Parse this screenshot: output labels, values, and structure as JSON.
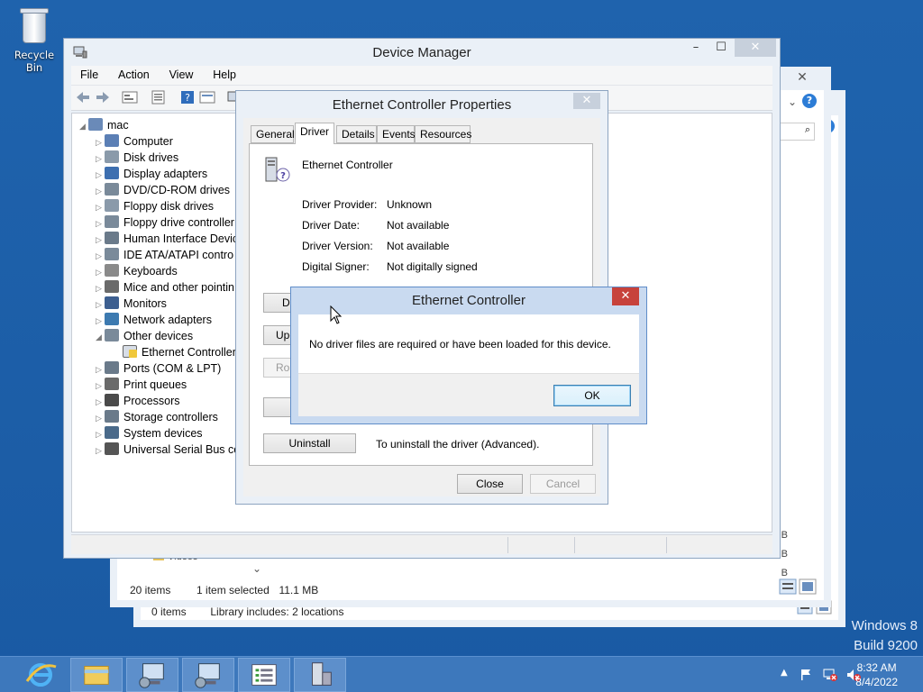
{
  "desktop": {
    "recycle_bin_label": "Recycle Bin",
    "watermark_line1": "Windows 8",
    "watermark_line2": "Build 9200"
  },
  "back_window_1": {
    "status_items": "0 items",
    "status_library": "Library includes: 2 locations"
  },
  "back_window_2": {
    "status_count": "20 items",
    "status_selected": "1 item selected",
    "status_size": "11.1 MB",
    "size_fragments": [
      "B",
      "B",
      "B"
    ],
    "partial_item": "Videos"
  },
  "device_manager": {
    "title": "Device Manager",
    "menu": [
      "File",
      "Action",
      "View",
      "Help"
    ],
    "tree": {
      "root": "mac",
      "categories": [
        {
          "label": "Computer",
          "expanded": false
        },
        {
          "label": "Disk drives",
          "expanded": false
        },
        {
          "label": "Display adapters",
          "expanded": false
        },
        {
          "label": "DVD/CD-ROM drives",
          "expanded": false
        },
        {
          "label": "Floppy disk drives",
          "expanded": false
        },
        {
          "label": "Floppy drive controller",
          "expanded": false
        },
        {
          "label": "Human Interface Devic",
          "expanded": false
        },
        {
          "label": "IDE ATA/ATAPI contro",
          "expanded": false
        },
        {
          "label": "Keyboards",
          "expanded": false
        },
        {
          "label": "Mice and other pointin",
          "expanded": false
        },
        {
          "label": "Monitors",
          "expanded": false
        },
        {
          "label": "Network adapters",
          "expanded": false
        },
        {
          "label": "Other devices",
          "expanded": true
        },
        {
          "label": "Ethernet Controller",
          "child": true
        },
        {
          "label": "Ports (COM & LPT)",
          "expanded": false
        },
        {
          "label": "Print queues",
          "expanded": false
        },
        {
          "label": "Processors",
          "expanded": false
        },
        {
          "label": "Storage controllers",
          "expanded": false
        },
        {
          "label": "System devices",
          "expanded": false
        },
        {
          "label": "Universal Serial Bus co",
          "expanded": false
        }
      ]
    }
  },
  "properties": {
    "title": "Ethernet Controller Properties",
    "tabs": [
      "General",
      "Driver",
      "Details",
      "Events",
      "Resources"
    ],
    "active_tab": "Driver",
    "device_name": "Ethernet Controller",
    "fields": [
      {
        "key": "Driver Provider:",
        "value": "Unknown"
      },
      {
        "key": "Driver Date:",
        "value": "Not available"
      },
      {
        "key": "Driver Version:",
        "value": "Not available"
      },
      {
        "key": "Digital Signer:",
        "value": "Not digitally signed"
      }
    ],
    "buttons_partial": [
      "Dr",
      "Upc",
      "Roll"
    ],
    "uninstall_label": "Uninstall",
    "uninstall_desc": "To uninstall the driver (Advanced).",
    "close_label": "Close",
    "cancel_label": "Cancel"
  },
  "message_box": {
    "title": "Ethernet Controller",
    "text": "No driver files are required or have been loaded for this device.",
    "ok_label": "OK"
  },
  "taskbar": {
    "time": "8:32 AM",
    "date": "8/4/2022"
  },
  "colors": {
    "desktop": "#1f63ad",
    "window_frame": "#eaf0f7",
    "close_red": "#c7423b",
    "taskbar": "#3d78bc"
  }
}
